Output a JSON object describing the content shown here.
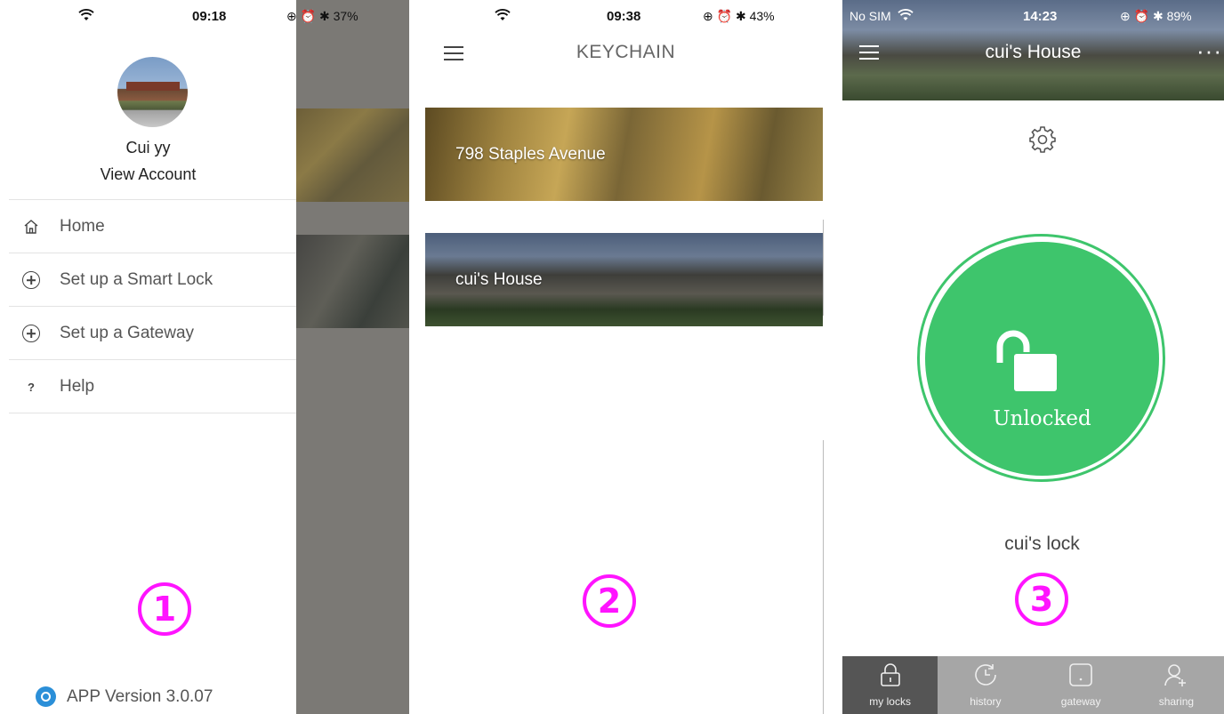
{
  "panel1": {
    "status": {
      "time": "09:18",
      "battery": "37%"
    },
    "user_name": "Cui yy",
    "view_account": "View Account",
    "menu": [
      {
        "label": "Home",
        "icon": "home-icon"
      },
      {
        "label": "Set up a Smart Lock",
        "icon": "plus-circle-icon"
      },
      {
        "label": "Set up a Gateway",
        "icon": "plus-circle-icon"
      },
      {
        "label": "Help",
        "icon": "question-icon",
        "glyph": "?"
      }
    ],
    "step_number": "1",
    "app_version": "APP Version 3.0.07"
  },
  "panel2": {
    "status": {
      "time": "09:38",
      "battery": "43%"
    },
    "title": "KEYCHAIN",
    "houses": [
      {
        "label": "798 Staples Avenue"
      },
      {
        "label": "cui's House"
      }
    ],
    "step_number": "2"
  },
  "panel3": {
    "status": {
      "carrier": "No SIM",
      "time": "14:23",
      "battery": "89%"
    },
    "title": "cui's House",
    "more": "···",
    "lock_state": "Unlocked",
    "lock_name": "cui's lock",
    "step_number": "3",
    "tabs": [
      {
        "label": "my locks",
        "icon": "padlock-icon",
        "active": true
      },
      {
        "label": "history",
        "icon": "history-clock-icon",
        "active": false
      },
      {
        "label": "gateway",
        "icon": "gateway-icon",
        "active": false
      },
      {
        "label": "sharing",
        "icon": "add-user-icon",
        "active": false
      }
    ]
  },
  "colors": {
    "accent_green": "#3ec56c",
    "annotation_magenta": "#ff14ff",
    "overlay_gray": "#7b7975",
    "tabbar_gray": "#a6a6a6",
    "tab_active": "#555555"
  }
}
